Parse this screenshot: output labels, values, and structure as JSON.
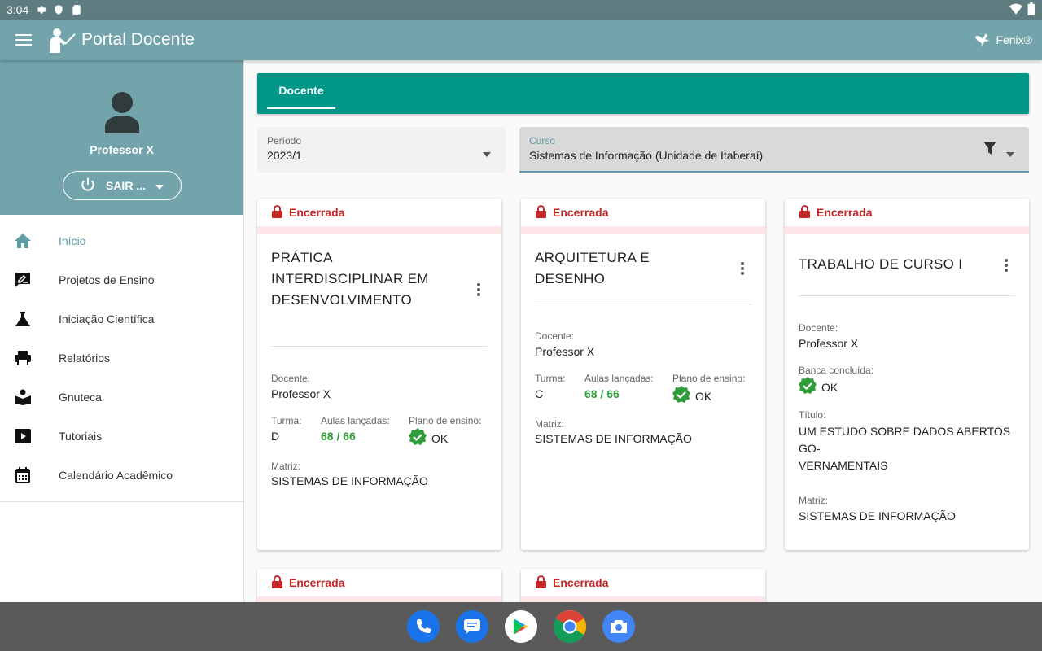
{
  "status_bar": {
    "time": "3:04"
  },
  "app": {
    "title": "Portal Docente",
    "brand": "Fenix®"
  },
  "profile": {
    "name": "Professor X",
    "logout_label": "SAIR ..."
  },
  "nav": [
    {
      "label": "Início",
      "icon": "home-icon"
    },
    {
      "label": "Projetos de Ensino",
      "icon": "rate-review-icon"
    },
    {
      "label": "Iniciação Científica",
      "icon": "flask-icon"
    },
    {
      "label": "Relatórios",
      "icon": "printer-icon"
    },
    {
      "label": "Gnuteca",
      "icon": "book-reader-icon"
    },
    {
      "label": "Tutoriais",
      "icon": "play-icon"
    },
    {
      "label": "Calendário Acadêmico",
      "icon": "calendar-icon"
    }
  ],
  "tabs": [
    {
      "label": "Docente"
    }
  ],
  "filters": {
    "periodo": {
      "label": "Período",
      "value": "2023/1"
    },
    "curso": {
      "label": "Curso",
      "value": "Sistemas de Informação (Unidade de Itaberaí)"
    }
  },
  "cards": [
    {
      "status": "Encerrada",
      "title_lines": [
        "PRÁTICA",
        "INTERDISCIPLINAR EM",
        "DESENVOLVIMENTO"
      ],
      "docente_label": "Docente:",
      "docente": "Professor X",
      "turma_label": "Turma:",
      "turma": "D",
      "aulas_label": "Aulas lançadas:",
      "aulas": "68 / 66",
      "plano_label": "Plano de ensino:",
      "plano": "OK",
      "matriz_label": "Matriz:",
      "matriz": "SISTEMAS DE INFORMAÇÃO"
    },
    {
      "status": "Encerrada",
      "title_lines": [
        "ARQUITETURA E",
        "DESENHO"
      ],
      "docente_label": "Docente:",
      "docente": "Professor X",
      "turma_label": "Turma:",
      "turma": "C",
      "aulas_label": "Aulas lançadas:",
      "aulas": "68 / 66",
      "plano_label": "Plano de ensino:",
      "plano": "OK",
      "matriz_label": "Matriz:",
      "matriz": "SISTEMAS DE INFORMAÇÃO"
    },
    {
      "status": "Encerrada",
      "title_lines": [
        "TRABALHO DE CURSO I"
      ],
      "docente_label": "Docente:",
      "docente": "Professor X",
      "banca_label": "Banca concluída:",
      "banca": "OK",
      "titulo_label": "Título:",
      "titulo_lines": [
        "UM ESTUDO SOBRE DADOS ABERTOS GO-",
        "VERNAMENTAIS"
      ],
      "matriz_label": "Matriz:",
      "matriz": "SISTEMAS DE INFORMAÇÃO"
    },
    {
      "status": "Encerrada"
    },
    {
      "status": "Encerrada"
    }
  ],
  "dock": [
    "phone-icon",
    "messages-icon",
    "play-store-icon",
    "chrome-icon",
    "camera-icon"
  ],
  "colors": {
    "app_bar": "#73a4ab",
    "tab_bar": "#009688",
    "status_red": "#c62828",
    "ok_green": "#2e9d3a"
  }
}
